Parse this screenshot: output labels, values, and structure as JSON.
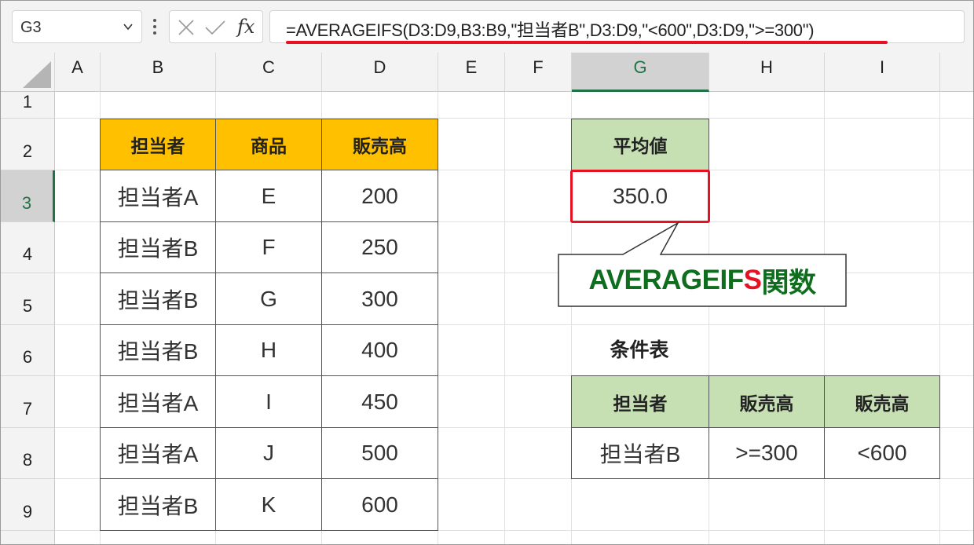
{
  "name_box": {
    "value": "G3"
  },
  "formula_bar": {
    "formula": "=AVERAGEIFS(D3:D9,B3:B9,\"担当者B\",D3:D9,\"<600\",D3:D9,\">=300\")"
  },
  "columns": [
    "A",
    "B",
    "C",
    "D",
    "E",
    "F",
    "G",
    "H",
    "I"
  ],
  "rows": [
    "1",
    "2",
    "3",
    "4",
    "5",
    "6",
    "7",
    "8",
    "9"
  ],
  "data_table": {
    "headers": [
      "担当者",
      "商品",
      "販売高"
    ],
    "rows": [
      [
        "担当者A",
        "E",
        "200"
      ],
      [
        "担当者B",
        "F",
        "250"
      ],
      [
        "担当者B",
        "G",
        "300"
      ],
      [
        "担当者B",
        "H",
        "400"
      ],
      [
        "担当者A",
        "I",
        "450"
      ],
      [
        "担当者A",
        "J",
        "500"
      ],
      [
        "担当者B",
        "K",
        "600"
      ]
    ]
  },
  "average": {
    "header": "平均値",
    "value": "350.0"
  },
  "callout": {
    "prefix": "AVERAGEIF",
    "highlight": "S",
    "suffix": "関数"
  },
  "criteria_table": {
    "caption": "条件表",
    "headers": [
      "担当者",
      "販売高",
      "販売高"
    ],
    "values": [
      "担当者B",
      ">=300",
      "<600"
    ]
  },
  "colors": {
    "orange_header": "#ffc000",
    "green_header": "#c6e0b4",
    "highlight_red": "#e81123",
    "excel_green": "#217346",
    "callout_text_green": "#0e6e1e"
  }
}
